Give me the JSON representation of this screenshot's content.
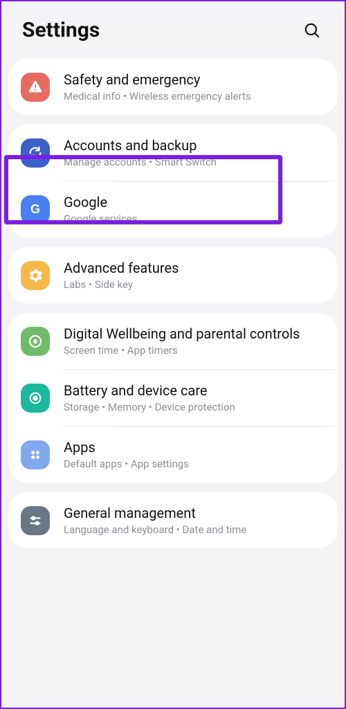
{
  "header": {
    "title": "Settings"
  },
  "groups": [
    {
      "items": [
        {
          "id": "safety",
          "title": "Safety and emergency",
          "sub": "Medical info  •  Wireless emergency alerts"
        }
      ]
    },
    {
      "items": [
        {
          "id": "accounts",
          "title": "Accounts and backup",
          "sub": "Manage accounts  •  Smart Switch"
        },
        {
          "id": "google",
          "title": "Google",
          "sub": "Google services"
        }
      ]
    },
    {
      "items": [
        {
          "id": "advanced",
          "title": "Advanced features",
          "sub": "Labs  •  Side key"
        }
      ]
    },
    {
      "items": [
        {
          "id": "wellbeing",
          "title": "Digital Wellbeing and parental controls",
          "sub": "Screen time  •  App timers"
        },
        {
          "id": "battery",
          "title": "Battery and device care",
          "sub": "Storage  •  Memory  •  Device protection"
        },
        {
          "id": "apps",
          "title": "Apps",
          "sub": "Default apps  •  App settings"
        }
      ]
    },
    {
      "items": [
        {
          "id": "general",
          "title": "General management",
          "sub": "Language and keyboard  •  Date and time"
        }
      ]
    }
  ]
}
